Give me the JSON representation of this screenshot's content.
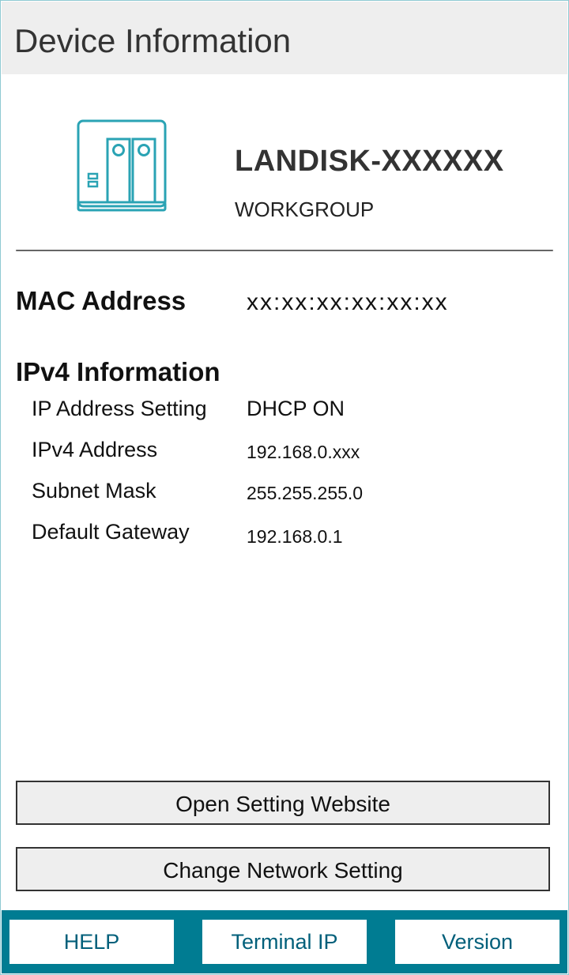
{
  "window": {
    "title": "Device Information"
  },
  "device": {
    "icon": "nas-device-icon",
    "name": "LANDISK-XXXXXX",
    "workgroup": "WORKGROUP"
  },
  "mac": {
    "label": "MAC Address",
    "value": "xx:xx:xx:xx:xx:xx"
  },
  "ipv4": {
    "heading": "IPv4 Information",
    "rows": [
      {
        "label": "IP Address Setting",
        "value": "DHCP ON"
      },
      {
        "label": "IPv4 Address",
        "value": "192.168.0.xxx"
      },
      {
        "label": "Subnet Mask",
        "value": "255.255.255.0"
      },
      {
        "label": "Default Gateway",
        "value": "192.168.0.1"
      }
    ]
  },
  "actions": {
    "open_setting_website": "Open Setting Website",
    "change_network_setting": "Change Network Setting"
  },
  "bottom_nav": {
    "help": "HELP",
    "terminal_ip": "Terminal IP",
    "version": "Version"
  },
  "colors": {
    "accent": "#007c92",
    "icon_teal": "#2aa3b4",
    "title_bar_bg": "#eeeeee",
    "button_bg": "#eeeeee"
  }
}
